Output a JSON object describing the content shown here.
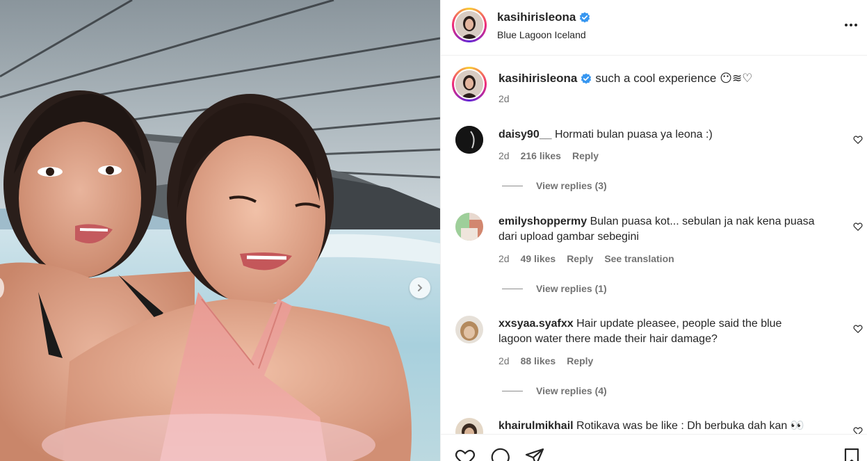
{
  "post": {
    "username": "kasihirisleona",
    "location": "Blue Lagoon Iceland",
    "caption_text": "such a cool experience",
    "caption_emoji": "😶≋♡",
    "time": "2d"
  },
  "comments": [
    {
      "username": "daisy90__",
      "text": "Hormati bulan puasa ya leona :)",
      "time": "2d",
      "likes": "216 likes",
      "reply_label": "Reply",
      "view_replies": "View replies (3)"
    },
    {
      "username": "emilyshoppermy",
      "text": "Bulan puasa kot... sebulan ja nak kena puasa",
      "text_line2": "dari upload gambar sebegini",
      "time": "2d",
      "likes": "49 likes",
      "reply_label": "Reply",
      "translation": "See translation",
      "view_replies": "View replies (1)"
    },
    {
      "username": "xxsyaa.syafxx",
      "text": "Hair update pleasee, people said the blue",
      "text_line2": "lagoon water there made their hair damage?",
      "time": "2d",
      "likes": "88 likes",
      "reply_label": "Reply",
      "view_replies": "View replies (4)"
    },
    {
      "username": "khairulmikhail",
      "text": "Rotikava was be like : Dh berbuka dah kan 👀"
    }
  ],
  "icons": {
    "verified": "verified-badge-icon",
    "more": "more-options-icon",
    "like": "heart-icon",
    "comment": "comment-icon",
    "share": "share-icon",
    "save": "bookmark-icon",
    "next": "chevron-right-icon"
  },
  "colors": {
    "verified": "#3897f0",
    "text": "#262626",
    "secondary": "#737373",
    "border": "#efefef"
  }
}
